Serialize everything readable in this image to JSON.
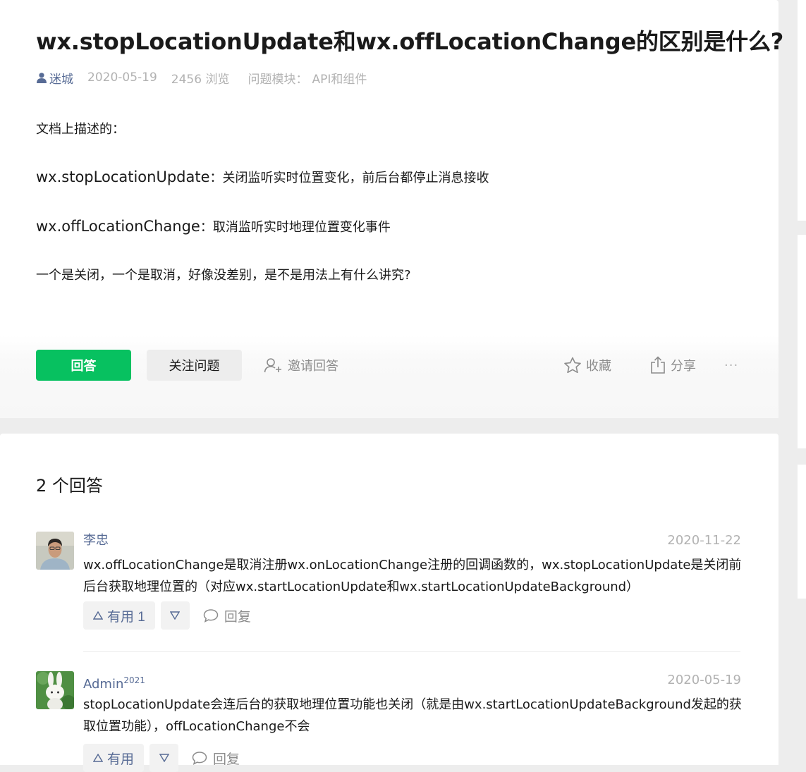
{
  "question": {
    "title": "wx.stopLocationUpdate和wx.offLocationChange的区别是什么?",
    "author": "迷城",
    "date": "2020-05-19",
    "views": "2456 浏览",
    "module_label": "问题模块：",
    "module_value": "API和组件",
    "body": {
      "line1": "文档上描述的：",
      "line2_code": "wx.stopLocationUpdate",
      "line2_text": "：关闭监听实时位置变化，前后台都停止消息接收",
      "line3_code": "wx.offLocationChange",
      "line3_text": "：取消监听实时地理位置变化事件",
      "line4": "一个是关闭，一个是取消，好像没差别，是不是用法上有什么讲究?"
    }
  },
  "actions": {
    "answer_label": "回答",
    "follow_label": "关注问题",
    "invite_label": "邀请回答",
    "collect_label": "收藏",
    "share_label": "分享",
    "more_label": "···"
  },
  "answers_section": {
    "count_label": "2 个回答",
    "items": [
      {
        "name": "李忠",
        "badge": "",
        "date": "2020-11-22",
        "body": "wx.offLocationChange是取消注册wx.onLocationChange注册的回调函数的，wx.stopLocationUpdate是关闭前后台获取地理位置的（对应wx.startLocationUpdate和wx.startLocationUpdateBackground）",
        "useful_label": "有用 1",
        "reply_label": "回复"
      },
      {
        "name": "Admin",
        "badge": "2021",
        "date": "2020-05-19",
        "body": "stopLocationUpdate会连后台的获取地理位置功能也关闭（就是由wx.startLocationUpdateBackground发起的获取位置功能），offLocationChange不会",
        "useful_label": "有用",
        "reply_label": "回复"
      }
    ]
  },
  "colors": {
    "primary_green": "#07c160",
    "link_blue": "#576b95",
    "muted_gray": "#b2b2b2"
  },
  "icons": [
    "user-icon",
    "add-user-icon",
    "star-icon",
    "share-icon",
    "thumb-up-triangle-icon",
    "thumb-down-triangle-icon",
    "comment-icon"
  ]
}
